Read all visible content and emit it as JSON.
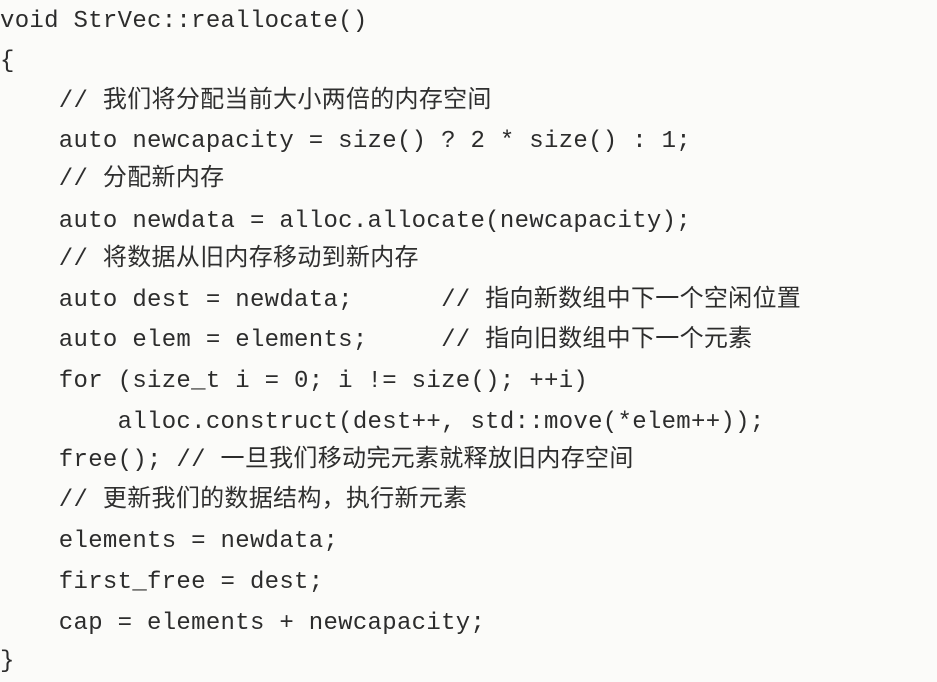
{
  "code": {
    "lines": [
      "void StrVec::reallocate()",
      "{",
      "    // 我们将分配当前大小两倍的内存空间",
      "    auto newcapacity = size() ? 2 * size() : 1;",
      "    // 分配新内存",
      "    auto newdata = alloc.allocate(newcapacity);",
      "    // 将数据从旧内存移动到新内存",
      "    auto dest = newdata;      // 指向新数组中下一个空闲位置",
      "    auto elem = elements;     // 指向旧数组中下一个元素",
      "    for (size_t i = 0; i != size(); ++i)",
      "        alloc.construct(dest++, std::move(*elem++));",
      "    free(); // 一旦我们移动完元素就释放旧内存空间",
      "    // 更新我们的数据结构，执行新元素",
      "    elements = newdata;",
      "    first_free = dest;",
      "    cap = elements + newcapacity;",
      "}"
    ]
  }
}
